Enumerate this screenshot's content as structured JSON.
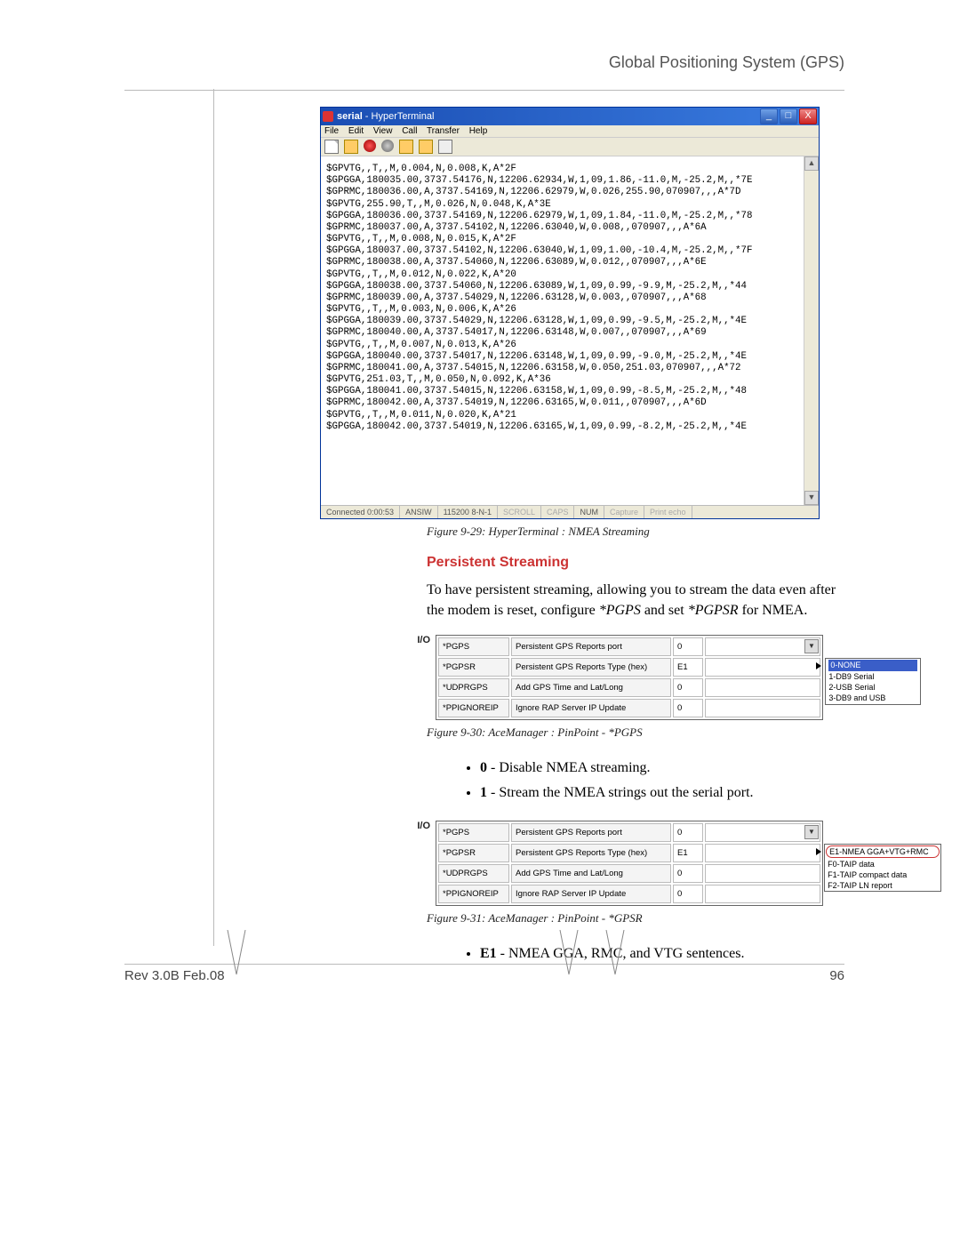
{
  "header": {
    "title": "Global Positioning System (GPS)"
  },
  "hyperterminal": {
    "title_prefix": "serial",
    "title_app": " - HyperTerminal",
    "menu": {
      "file": "File",
      "edit": "Edit",
      "view": "View",
      "call": "Call",
      "transfer": "Transfer",
      "help": "Help"
    },
    "ctrl_min": "_",
    "ctrl_max": "□",
    "ctrl_close": "X",
    "scroll_up": "▲",
    "scroll_down": "▼",
    "body": "$GPVTG,,T,,M,0.004,N,0.008,K,A*2F\n$GPGGA,180035.00,3737.54176,N,12206.62934,W,1,09,1.86,-11.0,M,-25.2,M,,*7E\n$GPRMC,180036.00,A,3737.54169,N,12206.62979,W,0.026,255.90,070907,,,A*7D\n$GPVTG,255.90,T,,M,0.026,N,0.048,K,A*3E\n$GPGGA,180036.00,3737.54169,N,12206.62979,W,1,09,1.84,-11.0,M,-25.2,M,,*78\n$GPRMC,180037.00,A,3737.54102,N,12206.63040,W,0.008,,070907,,,A*6A\n$GPVTG,,T,,M,0.008,N,0.015,K,A*2F\n$GPGGA,180037.00,3737.54102,N,12206.63040,W,1,09,1.00,-10.4,M,-25.2,M,,*7F\n$GPRMC,180038.00,A,3737.54060,N,12206.63089,W,0.012,,070907,,,A*6E\n$GPVTG,,T,,M,0.012,N,0.022,K,A*20\n$GPGGA,180038.00,3737.54060,N,12206.63089,W,1,09,0.99,-9.9,M,-25.2,M,,*44\n$GPRMC,180039.00,A,3737.54029,N,12206.63128,W,0.003,,070907,,,A*68\n$GPVTG,,T,,M,0.003,N,0.006,K,A*26\n$GPGGA,180039.00,3737.54029,N,12206.63128,W,1,09,0.99,-9.5,M,-25.2,M,,*4E\n$GPRMC,180040.00,A,3737.54017,N,12206.63148,W,0.007,,070907,,,A*69\n$GPVTG,,T,,M,0.007,N,0.013,K,A*26\n$GPGGA,180040.00,3737.54017,N,12206.63148,W,1,09,0.99,-9.0,M,-25.2,M,,*4E\n$GPRMC,180041.00,A,3737.54015,N,12206.63158,W,0.050,251.03,070907,,,A*72\n$GPVTG,251.03,T,,M,0.050,N,0.092,K,A*36\n$GPGGA,180041.00,3737.54015,N,12206.63158,W,1,09,0.99,-8.5,M,-25.2,M,,*48\n$GPRMC,180042.00,A,3737.54019,N,12206.63165,W,0.011,,070907,,,A*6D\n$GPVTG,,T,,M,0.011,N,0.020,K,A*21\n$GPGGA,180042.00,3737.54019,N,12206.63165,W,1,09,0.99,-8.2,M,-25.2,M,,*4E",
    "status": {
      "conn": "Connected 0:00:53",
      "emu": "ANSIW",
      "port": "115200 8-N-1",
      "scroll": "SCROLL",
      "caps": "CAPS",
      "num": "NUM",
      "capture": "Capture",
      "echo": "Print echo"
    }
  },
  "captions": {
    "fig29": "Figure 9-29:  HyperTerminal : NMEA Streaming",
    "fig30": "Figure 9-30:  AceManager : PinPoint - *PGPS",
    "fig31": "Figure 9-31:  AceManager : PinPoint - *GPSR"
  },
  "section": {
    "heading": "Persistent Streaming",
    "para_pre": "To have persistent streaming, allowing you to stream the data even after the modem is reset, configure ",
    "para_i1": "*PGPS",
    "para_mid": " and set ",
    "para_i2": "*PGPSR",
    "para_post": " for NMEA."
  },
  "io_label": "I/O",
  "table1": {
    "rows": [
      {
        "c1": "*PGPS",
        "c2": "Persistent GPS Reports port",
        "c3": "0",
        "c4": ""
      },
      {
        "c1": "*PGPSR",
        "c2": "Persistent GPS Reports Type (hex)",
        "c3": "E1",
        "c4": ""
      },
      {
        "c1": "*UDPRGPS",
        "c2": "Add GPS Time and Lat/Long",
        "c3": "0",
        "c4": ""
      },
      {
        "c1": "*PPIGNOREIP",
        "c2": "Ignore RAP Server IP Update",
        "c3": "0",
        "c4": ""
      }
    ],
    "dropdown": {
      "o0": "0-NONE",
      "o1": "1-DB9 Serial",
      "o2": "2-USB Serial",
      "o3": "3-DB9 and USB"
    }
  },
  "bullets1": {
    "b0_bold": "0",
    "b0_rest": " - Disable NMEA streaming.",
    "b1_bold": "1",
    "b1_rest": " - Stream the NMEA strings out the serial port."
  },
  "table2": {
    "rows": [
      {
        "c1": "*PGPS",
        "c2": "Persistent GPS Reports port",
        "c3": "0",
        "c4": ""
      },
      {
        "c1": "*PGPSR",
        "c2": "Persistent GPS Reports Type (hex)",
        "c3": "E1",
        "c4": ""
      },
      {
        "c1": "*UDPRGPS",
        "c2": "Add GPS Time and Lat/Long",
        "c3": "0",
        "c4": ""
      },
      {
        "c1": "*PPIGNOREIP",
        "c2": "Ignore RAP Server IP Update",
        "c3": "0",
        "c4": ""
      }
    ],
    "dropdown": {
      "sel": "E1-NMEA GGA+VTG+RMC",
      "o1": "F0-TAIP data",
      "o2": "F1-TAIP compact data",
      "o3": "F2-TAIP LN report"
    }
  },
  "bullets2": {
    "b0_bold": "E1",
    "b0_rest": " - NMEA GGA, RMC, and VTG sentences."
  },
  "footer": {
    "rev": "Rev 3.0B  Feb.08",
    "page": "96"
  }
}
